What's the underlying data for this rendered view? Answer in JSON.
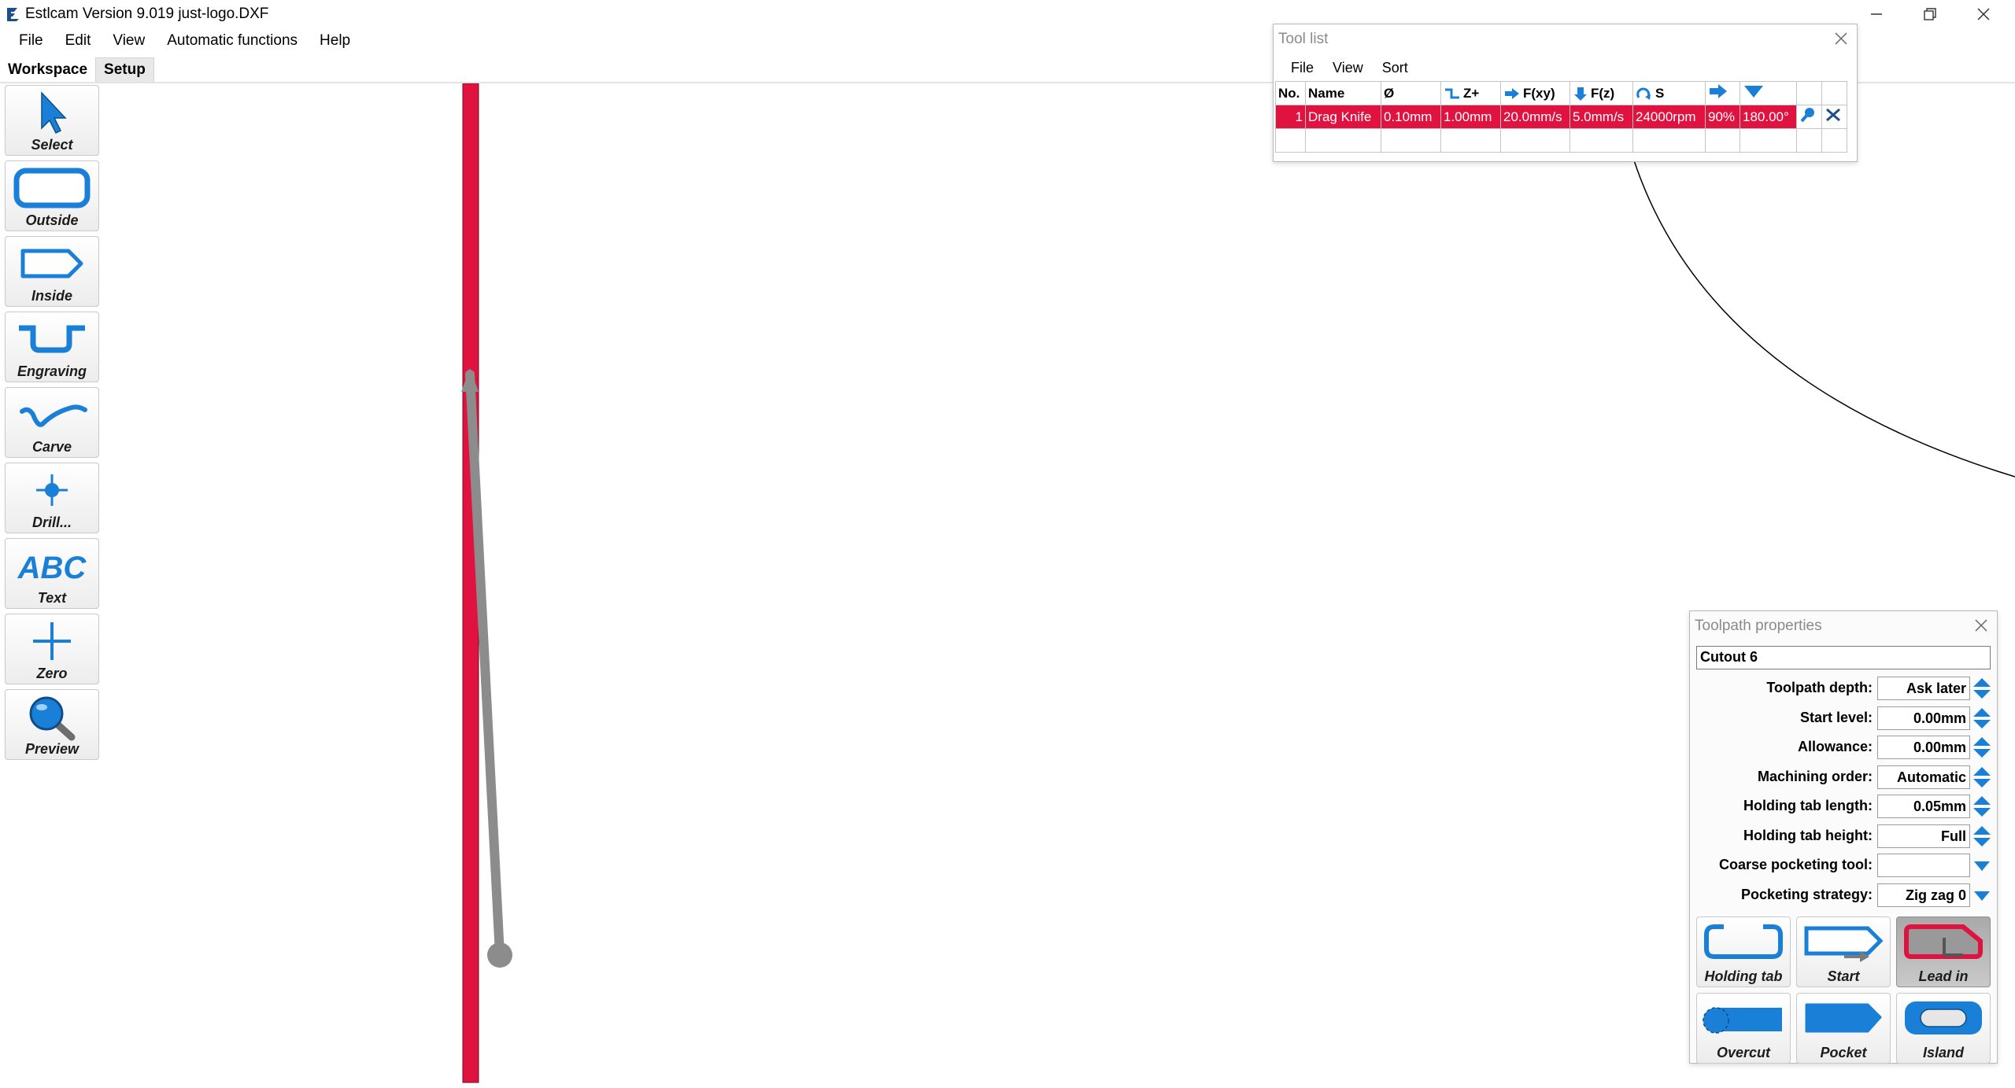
{
  "window": {
    "title": "Estlcam Version 9.019 just-logo.DXF"
  },
  "menu": [
    "File",
    "Edit",
    "View",
    "Automatic functions",
    "Help"
  ],
  "tabs": {
    "workspace": "Workspace",
    "setup": "Setup"
  },
  "toolbar": [
    {
      "label": "Select",
      "icon": "cursor-arrow-icon"
    },
    {
      "label": "Outside",
      "icon": "outside-contour-icon"
    },
    {
      "label": "Inside",
      "icon": "inside-contour-icon"
    },
    {
      "label": "Engraving",
      "icon": "engraving-icon"
    },
    {
      "label": "Carve",
      "icon": "carve-icon"
    },
    {
      "label": "Drill...",
      "icon": "drill-crosshair-icon"
    },
    {
      "label": "Text",
      "icon": "abc-text-icon"
    },
    {
      "label": "Zero",
      "icon": "zero-plus-icon"
    },
    {
      "label": "Preview",
      "icon": "magnifier-icon"
    }
  ],
  "tool_list": {
    "title": "Tool list",
    "menu": [
      "File",
      "View",
      "Sort"
    ],
    "headers": [
      "No.",
      "Name",
      "Ø",
      "Z+",
      "F(xy)",
      "F(z)",
      "S",
      "",
      "",
      "",
      ""
    ],
    "rows": [
      [
        "1",
        "Drag Knife",
        "0.10mm",
        "1.00mm",
        "20.0mm/s",
        "5.0mm/s",
        "24000rpm",
        "90%",
        "180.00°"
      ]
    ]
  },
  "toolpath_properties": {
    "title": "Toolpath properties",
    "name": "Cutout 6",
    "fields": [
      {
        "label": "Toolpath depth:",
        "value": "Ask later",
        "control": "spin"
      },
      {
        "label": "Start level:",
        "value": "0.00mm",
        "control": "spin"
      },
      {
        "label": "Allowance:",
        "value": "0.00mm",
        "control": "spin"
      },
      {
        "label": "Machining order:",
        "value": "Automatic",
        "control": "spin"
      },
      {
        "label": "Holding tab length:",
        "value": "0.05mm",
        "control": "spin"
      },
      {
        "label": "Holding tab height:",
        "value": "Full",
        "control": "spin"
      },
      {
        "label": "Coarse pocketing tool:",
        "value": "",
        "control": "dropdown"
      },
      {
        "label": "Pocketing strategy:",
        "value": "Zig zag 0",
        "control": "dropdown"
      }
    ],
    "buttons": [
      {
        "label": "Holding tab",
        "icon": "holding-tab-icon",
        "pressed": false
      },
      {
        "label": "Start",
        "icon": "start-point-icon",
        "pressed": false
      },
      {
        "label": "Lead in",
        "icon": "lead-in-icon",
        "pressed": true
      },
      {
        "label": "Overcut",
        "icon": "overcut-icon",
        "pressed": false
      },
      {
        "label": "Pocket",
        "icon": "pocket-icon",
        "pressed": false
      },
      {
        "label": "Island",
        "icon": "island-icon",
        "pressed": false
      }
    ]
  },
  "colors": {
    "accent_blue": "#1a7fd6",
    "selection_red": "#e0123f",
    "toolpath_gray": "#8c8c8c"
  }
}
